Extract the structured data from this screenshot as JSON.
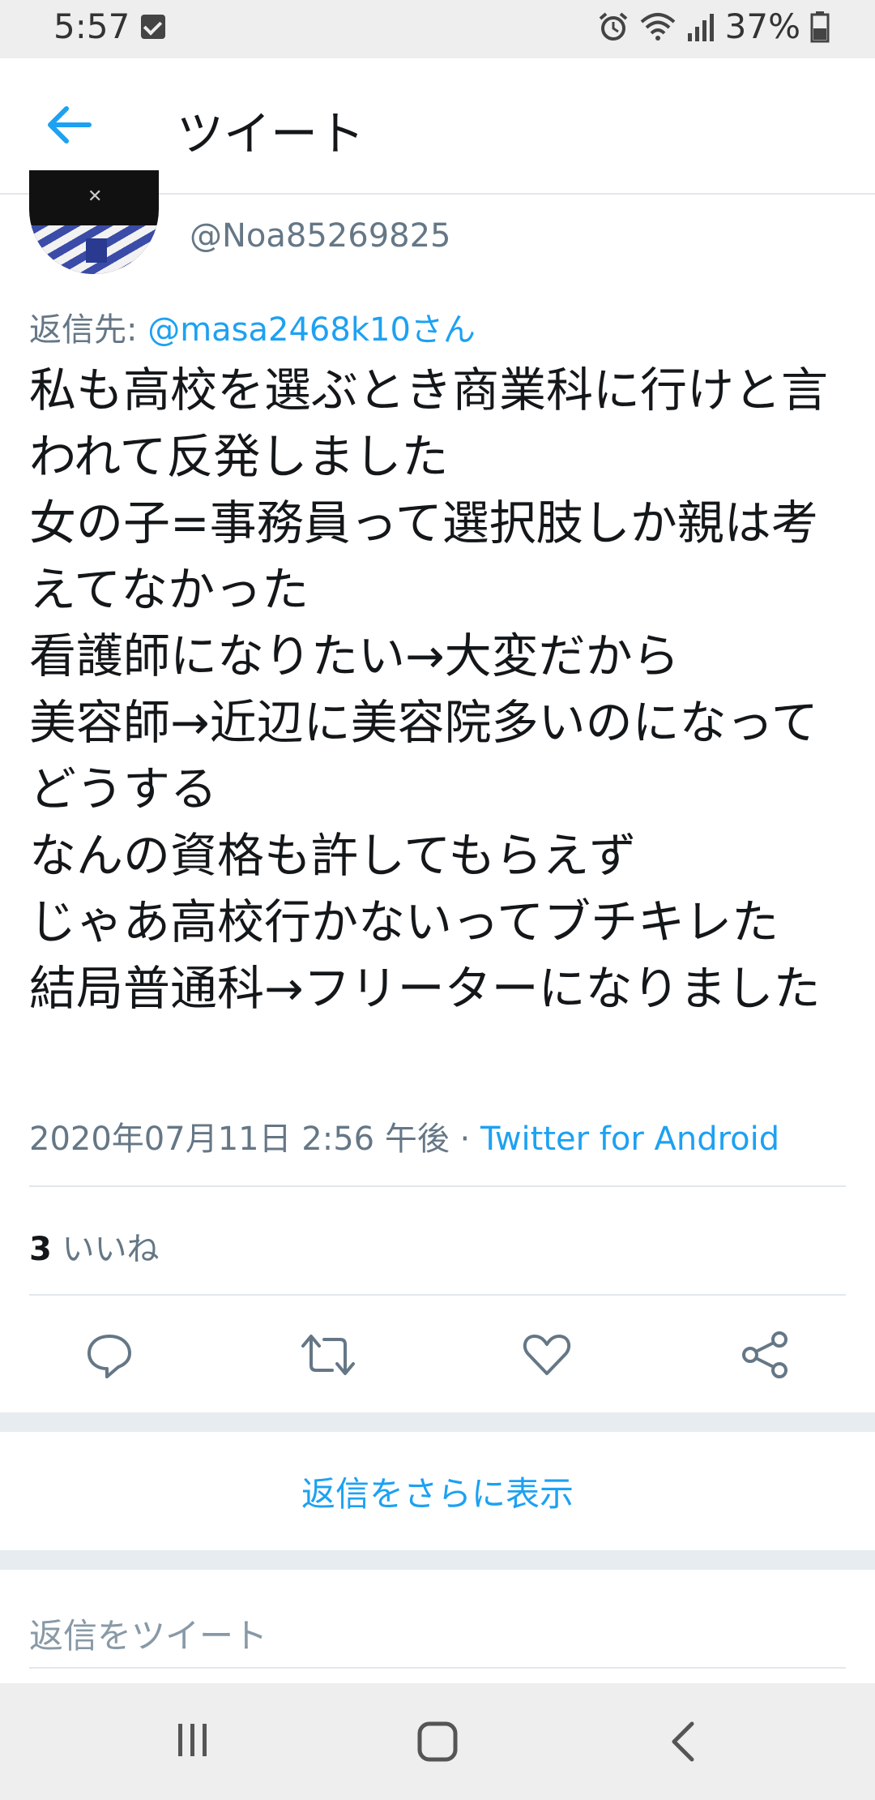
{
  "status_bar": {
    "time": "5:57",
    "battery": "37%",
    "icons": [
      "checkbox-icon",
      "alarm-icon",
      "wifi-icon",
      "signal-icon",
      "battery-icon"
    ]
  },
  "header": {
    "title": "ツイート",
    "back_icon": "arrow-left-icon"
  },
  "tweet": {
    "handle": "@Noa85269825",
    "reply_label": "返信先: ",
    "reply_user": "@masa2468k10さん",
    "text": "私も高校を選ぶとき商業科に行けと言われて反発しました\n女の子=事務員って選択肢しか親は考えてなかった\n看護師になりたい→大変だから\n美容師→近辺に美容院多いのになってどうする\nなんの資格も許してもらえず\nじゃあ高校行かないってブチキレた\n結局普通科→フリーターになりました",
    "timestamp": "2020年07月11日 2:56 午後 · ",
    "source": "Twitter for Android",
    "likes_count": "3",
    "likes_label": " いいね"
  },
  "actions": [
    "reply-icon",
    "retweet-icon",
    "like-icon",
    "share-icon"
  ],
  "more_replies_label": "返信をさらに表示",
  "reply_placeholder": "返信をツイート",
  "colors": {
    "accent": "#1da1f2",
    "secondary_text": "#657786",
    "divider": "#e1e8ed"
  }
}
